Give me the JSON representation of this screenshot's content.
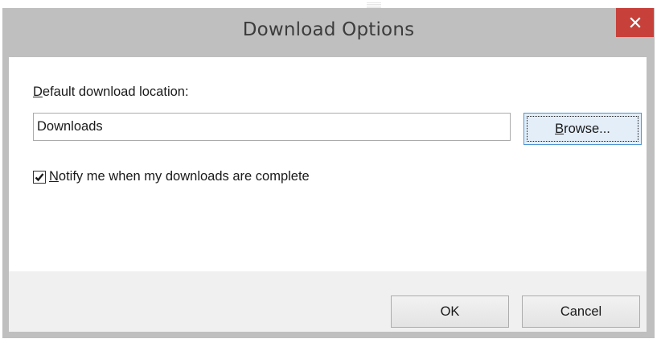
{
  "window": {
    "title": "Download Options",
    "close_icon": "close-icon"
  },
  "location": {
    "label_accel": "D",
    "label_rest": "efault download location:",
    "value": "Downloads"
  },
  "browse": {
    "label_accel": "B",
    "label_rest": "rowse..."
  },
  "notify": {
    "checked": true,
    "label_accel": "N",
    "label_rest": "otify me when my downloads are complete"
  },
  "footer": {
    "ok_label": "OK",
    "cancel_label": "Cancel"
  },
  "colors": {
    "close_button": "#c7403a",
    "titlebar": "#bfbfbf",
    "focus_border": "#4f94d4"
  }
}
